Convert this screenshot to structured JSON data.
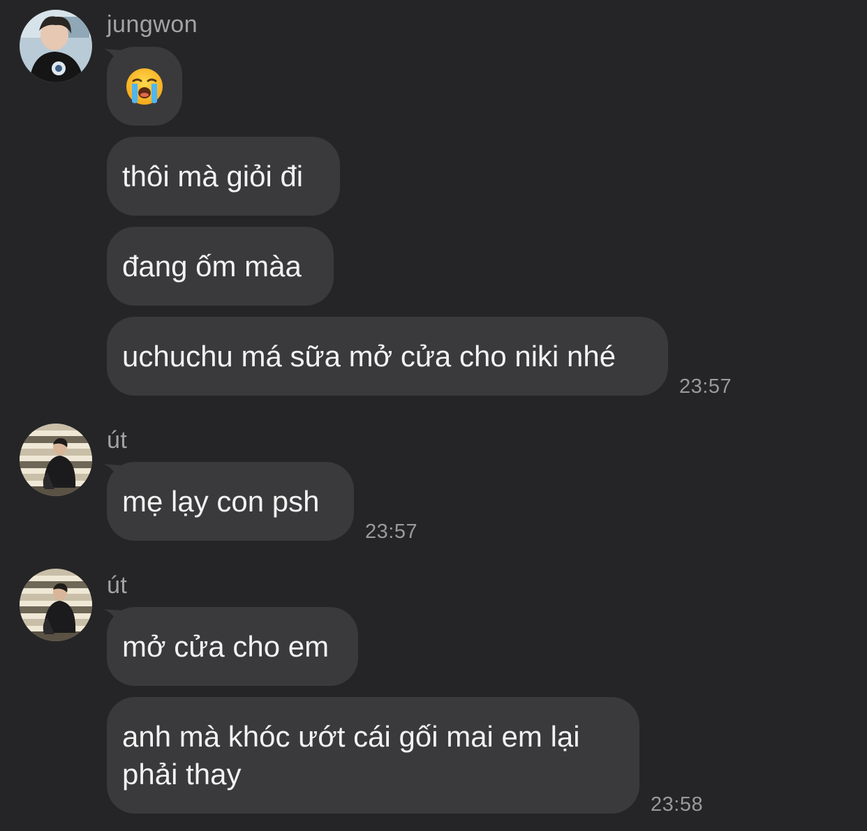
{
  "colors": {
    "background": "#252527",
    "bubble": "#3a3a3c",
    "text": "#f2f2f2",
    "meta": "#a3a3a3"
  },
  "groups": [
    {
      "sender": "jungwon",
      "avatar_icon": "profile-photo-jungwon",
      "messages": [
        {
          "emoji": "loudly-crying-face-emoji"
        },
        {
          "text": "thôi mà giỏi đi"
        },
        {
          "text": "đang ốm màa"
        },
        {
          "text": "uchuchu má sữa mở cửa cho niki nhé"
        }
      ],
      "time": "23:57"
    },
    {
      "sender": "út",
      "avatar_icon": "profile-photo-ut",
      "messages": [
        {
          "text": "mẹ lạy con psh"
        }
      ],
      "time": "23:57"
    },
    {
      "sender": "út",
      "avatar_icon": "profile-photo-ut",
      "messages": [
        {
          "text": "mở cửa cho em"
        },
        {
          "text": "anh mà khóc ướt cái gối mai em lại phải thay"
        }
      ],
      "time": "23:58"
    }
  ]
}
